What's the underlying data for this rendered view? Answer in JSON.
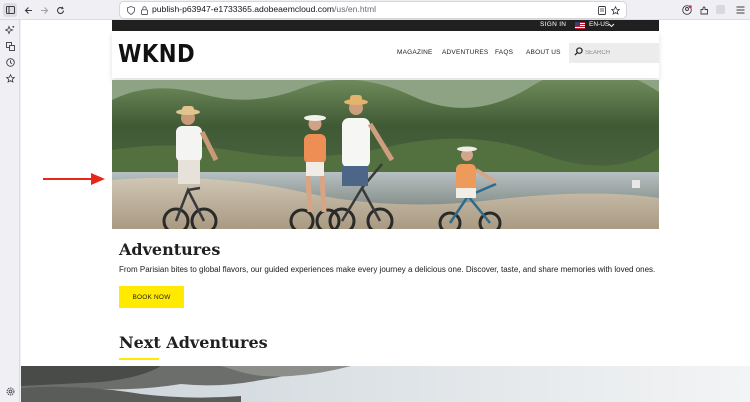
{
  "browser": {
    "url_host": "publish-p63947-e1733365.adobeaemcloud.com",
    "url_path": "/us/en.html"
  },
  "topbar": {
    "sign_in": "SIGN IN",
    "locale": "EN-US"
  },
  "header": {
    "logo": "WKND",
    "nav": [
      "MAGAZINE",
      "ADVENTURES",
      "FAQS",
      "ABOUT US"
    ],
    "search_placeholder": "SEARCH"
  },
  "main": {
    "adventures_title": "Adventures",
    "adventures_text": "From Parisian bites to global flavors, our guided experiences make every journey a delicious one. Discover, taste, and share memories with loved ones.",
    "book_now": "BOOK NOW",
    "next_title": "Next Adventures"
  },
  "colors": {
    "accent": "#ffea00",
    "annotation_arrow": "#e8261a",
    "topbar": "#202020"
  },
  "icons": [
    "sidebar-icon",
    "back-icon",
    "forward-icon",
    "reload-icon",
    "shield-icon",
    "lock-icon",
    "reader-icon",
    "star-icon",
    "account-icon",
    "extensions-icon",
    "menu-icon",
    "ai-icon",
    "synced-tabs-icon",
    "history-icon",
    "bookmarks-icon",
    "settings-icon",
    "flag-icon",
    "chevron-down-icon",
    "search-icon",
    "arrow-annotation"
  ]
}
